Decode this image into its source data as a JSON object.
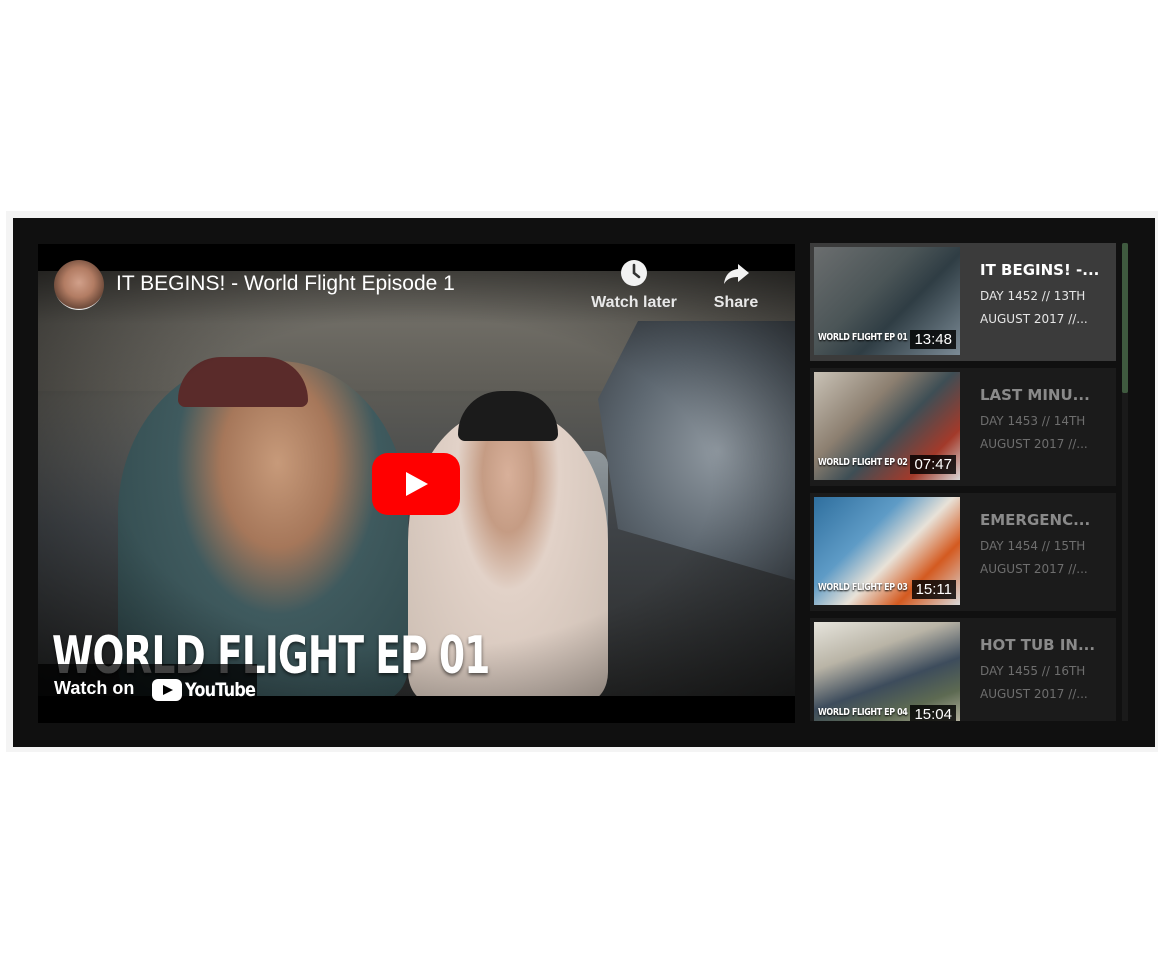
{
  "player": {
    "video_title": "IT BEGINS! - World Flight Episode 1",
    "overlay_text": "WORLD FLIGHT EP 01",
    "watch_later_label": "Watch later",
    "share_label": "Share",
    "watch_on_label": "Watch on",
    "youtube_label": "YouTube"
  },
  "playlist": {
    "items": [
      {
        "title": "IT BEGINS! -...",
        "desc_line1": "DAY 1452 // 13TH",
        "desc_line2": "AUGUST 2017 //...",
        "duration": "13:48",
        "thumb_brand": "WORLD FLIGHT EP 01",
        "active": true
      },
      {
        "title": "LAST MINU...",
        "desc_line1": "DAY 1453 // 14TH",
        "desc_line2": "AUGUST 2017 //...",
        "duration": "07:47",
        "thumb_brand": "WORLD FLIGHT EP 02",
        "active": false
      },
      {
        "title": "EMERGENC...",
        "desc_line1": "DAY 1454 // 15TH",
        "desc_line2": "AUGUST 2017 //...",
        "duration": "15:11",
        "thumb_brand": "WORLD FLIGHT EP 03",
        "active": false
      },
      {
        "title": "HOT TUB IN...",
        "desc_line1": "DAY 1455 // 16TH",
        "desc_line2": "AUGUST 2017 //...",
        "duration": "15:04",
        "thumb_brand": "WORLD FLIGHT EP 04",
        "active": false
      }
    ]
  },
  "colors": {
    "background": "#101010",
    "play_button": "#ff0000",
    "active_item": "#3b3b3b",
    "scrollbar_thumb": "#3f5a3f"
  },
  "icons": [
    "clock-icon",
    "share-arrow-icon",
    "play-icon",
    "youtube-logo-icon"
  ]
}
